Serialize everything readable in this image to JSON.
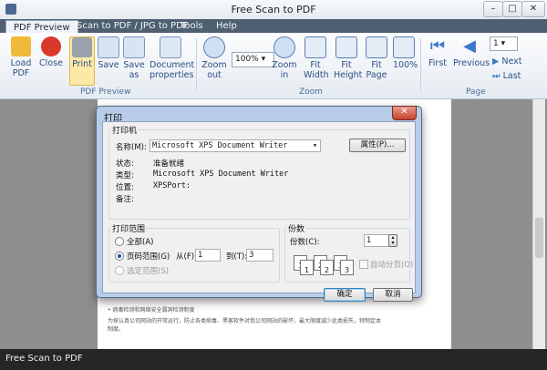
{
  "window": {
    "title": "Free Scan to PDF",
    "min": "–",
    "max": "□",
    "close": "✕"
  },
  "menu": {
    "tabs": [
      "PDF Preview",
      "Scan to PDF / JPG to PDF",
      "Tools",
      "Help"
    ]
  },
  "ribbon": {
    "pdf_preview": {
      "group": "PDF Preview",
      "buttons": [
        "Load PDF",
        "Close",
        "Print",
        "Save",
        "Save as",
        "Document properties"
      ]
    },
    "zoom": {
      "group": "Zoom",
      "zoom_out": "Zoom out",
      "zoom_value": "100%",
      "zoom_in": "Zoom in",
      "fit_width": "Fit Width",
      "fit_height": "Fit Height",
      "fit_page": "Fit Page",
      "hundred": "100%"
    },
    "page": {
      "group": "Page",
      "first": "First",
      "previous": "Previous",
      "page_value": "1",
      "next": "Next",
      "last": "Last"
    }
  },
  "document": {
    "line1": "• 病毒检测和网络安全漏洞检测制度",
    "line2": "为探认真公司网站的开常运行，防止各类病毒、黑客软件对我公司网站的破坏，最大限度减少此类损失，特制定本",
    "line3": "制度。"
  },
  "dialog": {
    "title": "打印",
    "close": "✕",
    "printer_group": "打印机",
    "name_label": "名称(M):",
    "name_value": "Microsoft XPS Document Writer",
    "properties_button": "属性(P)...",
    "status_label": "状态:",
    "status_value": "准备就绪",
    "type_label": "类型:",
    "type_value": "Microsoft XPS Document Writer",
    "location_label": "位置:",
    "location_value": "XPSPort:",
    "comment_label": "备注:",
    "range_group": "打印范围",
    "all_label": "全部(A)",
    "pages_label": "页码范围(G)",
    "from_label": "从(F):",
    "from_value": "1",
    "to_label": "到(T):",
    "to_value": "3",
    "selection_label": "选定范围(S)",
    "copies_group": "份数",
    "copies_label": "份数(C):",
    "copies_value": "1",
    "collate_label": "自动分页(O)",
    "ok_button": "确定",
    "cancel_button": "取消"
  },
  "status": {
    "text": "Free Scan to PDF"
  }
}
